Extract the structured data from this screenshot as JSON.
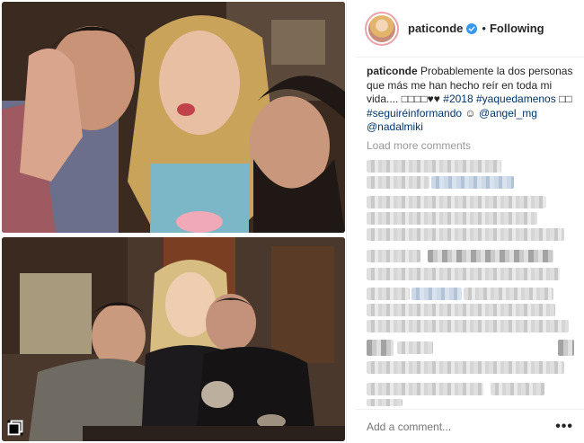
{
  "post": {
    "username": "paticonde",
    "follow_status": "Following",
    "separator": "•",
    "verified_icon": "verified-badge-icon",
    "caption_user": "paticonde",
    "caption_text": "Probablemente la dos personas que más me han hecho reír en toda mi vida.... ",
    "caption_emojis": "□□□□♥♥",
    "hashtag_2018": "#2018",
    "hashtag_yaquedamenos": "#yaquedamenos",
    "caption_mid_emoji": "□□",
    "hashtag_seguire": "#seguiréinformando",
    "caption_end_emoji": "☺",
    "mention_angel": "@angel_mg",
    "mention_nadal": "@nadalmiki",
    "load_more": "Load more comments",
    "comment_placeholder": "Add a comment...",
    "more_options": "•••",
    "link_color": "#003569",
    "muted_color": "#999999"
  },
  "icons": {
    "gallery": "gallery-icon",
    "more": "more-options-icon"
  }
}
